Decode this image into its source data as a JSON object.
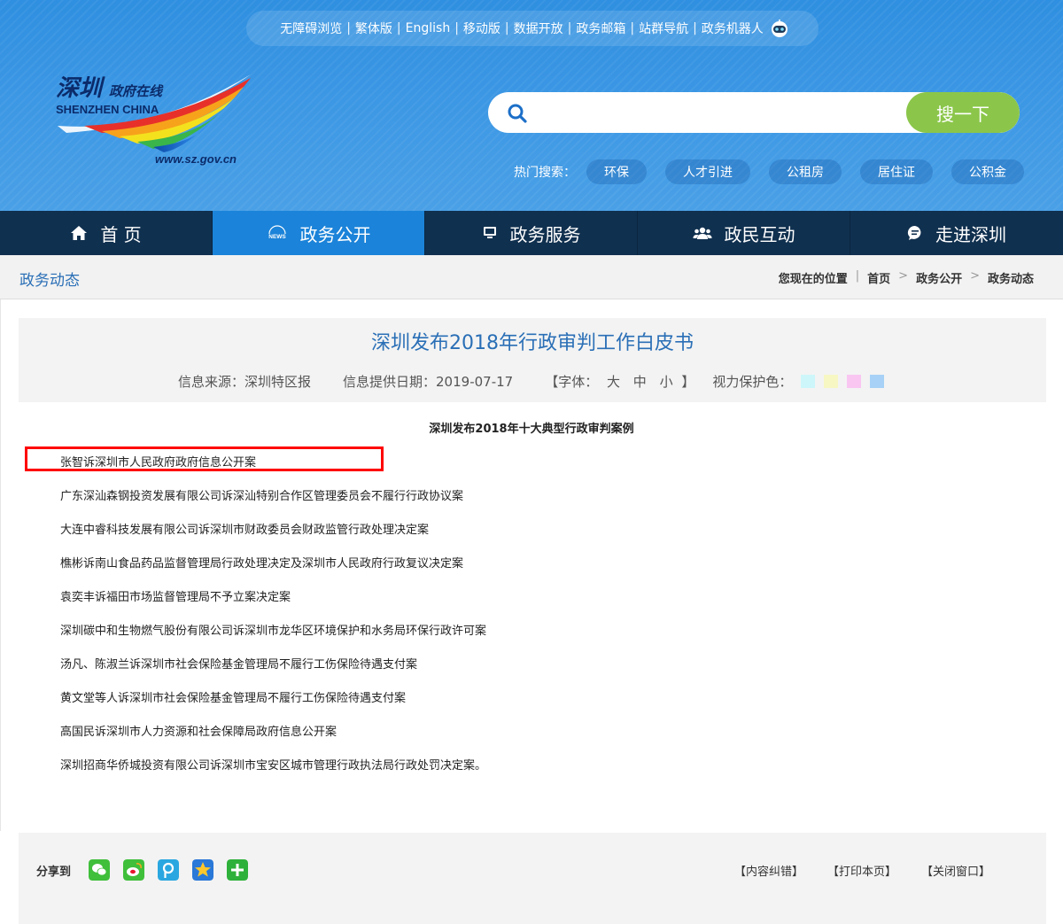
{
  "topbar": {
    "links": [
      "无障碍浏览",
      "繁体版",
      "English",
      "移动版",
      "数据开放",
      "政务邮箱",
      "站群导航",
      "政务机器人"
    ]
  },
  "logo": {
    "name_cn": "深圳",
    "slogan": "政府在线",
    "name_en": "SHENZHEN  CHINA",
    "url": "www.sz.gov.cn"
  },
  "search": {
    "placeholder": "",
    "button_label": "搜一下"
  },
  "hot_search": {
    "label": "热门搜索：",
    "tags": [
      "环保",
      "人才引进",
      "公租房",
      "居住证",
      "公积金"
    ]
  },
  "nav": {
    "items": [
      {
        "label": "首 页",
        "icon": "home-icon"
      },
      {
        "label": "政务公开",
        "icon": "news-icon"
      },
      {
        "label": "政务服务",
        "icon": "monitor-icon"
      },
      {
        "label": "政民互动",
        "icon": "users-icon"
      },
      {
        "label": "走进深圳",
        "icon": "chat-icon"
      }
    ],
    "active_index": 1
  },
  "section": {
    "title": "政务动态",
    "breadcrumb": [
      "您现在的位置",
      "首页",
      "政务公开",
      "政务动态"
    ]
  },
  "article": {
    "title": "深圳发布2018年行政审判工作白皮书",
    "source": "信息来源：深圳特区报",
    "date": "信息提供日期：2019-07-17",
    "font_label_open": "【字体：",
    "font_sizes": [
      "大",
      "中",
      "小"
    ],
    "font_label_close": "】",
    "eye_label": "视力保护色：",
    "eye_colors": [
      "#cdf6fa",
      "#f7f7c4",
      "#f9c6f2",
      "#a7d1f7"
    ],
    "subtitle": "深圳发布2018年十大典型行政审判案例",
    "cases": [
      "张智诉深圳市人民政府政府信息公开案",
      "广东深汕森钢投资发展有限公司诉深汕特别合作区管理委员会不履行行政协议案",
      "大连中睿科技发展有限公司诉深圳市财政委员会财政监管行政处理决定案",
      "樵彬诉南山食品药品监督管理局行政处理决定及深圳市人民政府行政复议决定案",
      "袁奕丰诉福田市场监督管理局不予立案决定案",
      "深圳碳中和生物燃气股份有限公司诉深圳市龙华区环境保护和水务局环保行政许可案",
      "汤凡、陈淑兰诉深圳市社会保险基金管理局不履行工伤保险待遇支付案",
      "黄文堂等人诉深圳市社会保险基金管理局不履行工伤保险待遇支付案",
      "高国民诉深圳市人力资源和社会保障局政府信息公开案",
      "深圳招商华侨城投资有限公司诉深圳市宝安区城市管理行政执法局行政处罚决定案。"
    ],
    "highlighted_case_index": 0
  },
  "footer": {
    "share_label": "分享到",
    "share_icons": [
      "wechat-icon",
      "weibo-icon",
      "tencent-icon",
      "qzone-icon",
      "more-icon"
    ],
    "actions": [
      "【内容纠错】",
      "【打印本页】",
      "【关闭窗口】"
    ]
  }
}
